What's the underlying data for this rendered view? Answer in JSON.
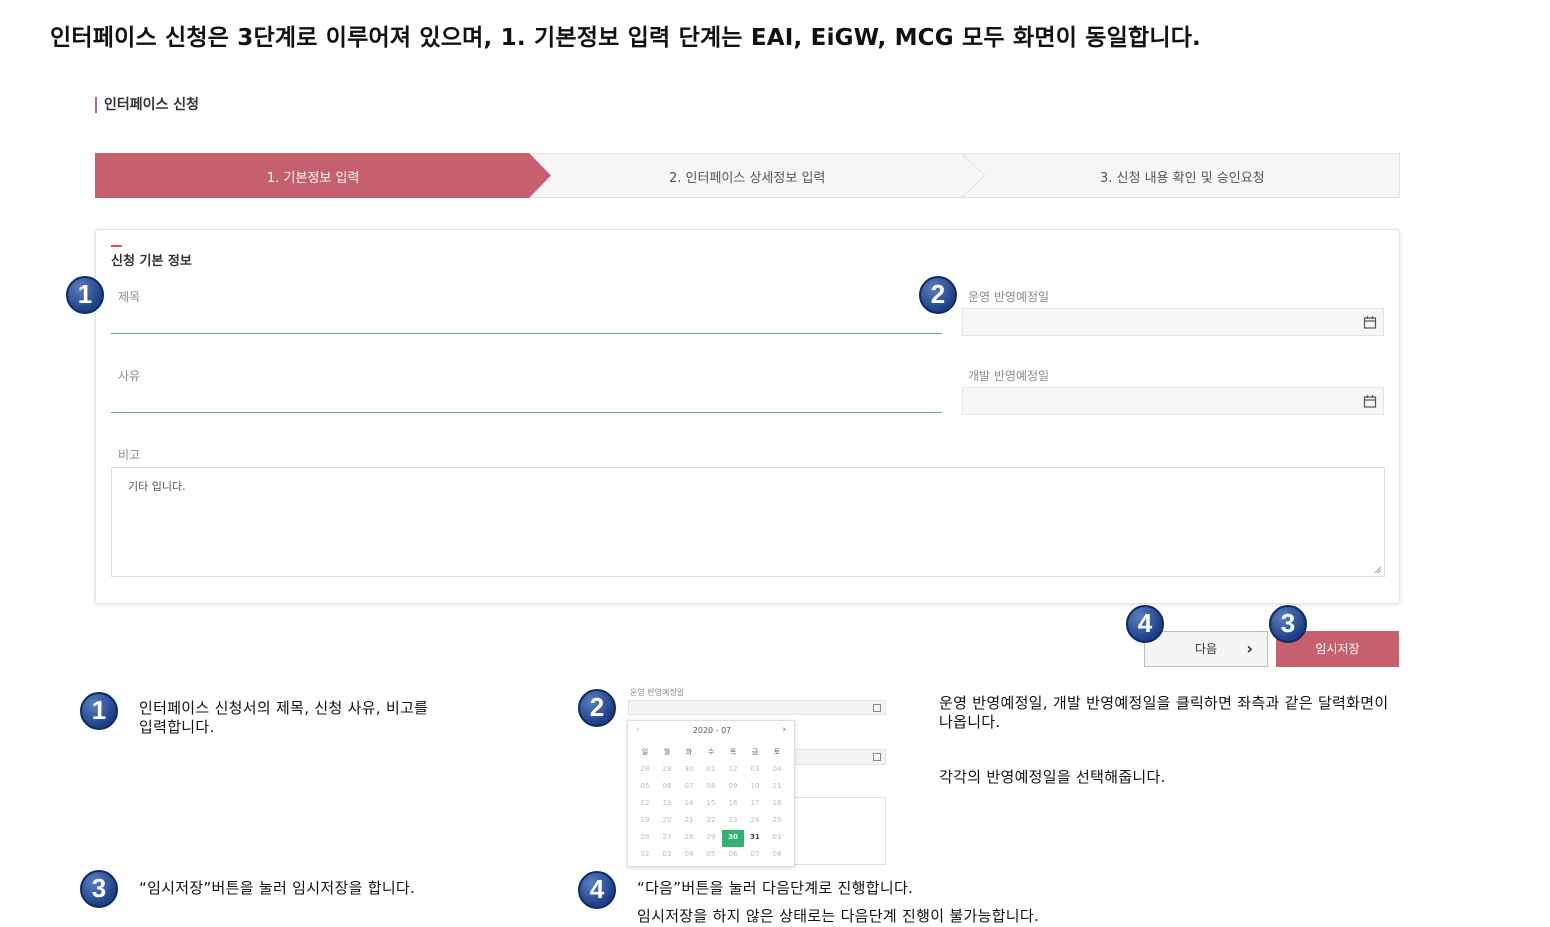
{
  "headline": "인터페이스 신청은 3단계로 이루어져 있으며, 1. 기본정보 입력 단계는 EAI, EiGW, MCG 모두 화면이 동일합니다.",
  "page_title": "인터페이스 신청",
  "steps": [
    {
      "label": "1. 기본정보 입력"
    },
    {
      "label": "2. 인터페이스 상세정보 입력"
    },
    {
      "label": "3. 신청 내용 확인 및 승인요청"
    }
  ],
  "form": {
    "section_title": "신청 기본 정보",
    "title_label": "제목",
    "reason_label": "사유",
    "note_label": "비고",
    "note_value": "기타 입니다.",
    "ops_date_label": "운영 반영예정일",
    "dev_date_label": "개발 반영예정일"
  },
  "buttons": {
    "next": "다음",
    "temp_save": "임시저장"
  },
  "badges": [
    "1",
    "2",
    "3",
    "4"
  ],
  "descriptions": {
    "d1": "인터페이스 신청서의 제목, 신청 사유, 비고를",
    "d1b": "입력합니다.",
    "d2a": "운영 반영예정일, 개발 반영예정일을 클릭하면 좌측과 같은 달력화면이",
    "d2b": "나옵니다.",
    "d2c": "각각의 반영예정일을 선택해줍니다.",
    "d3": "“임시저장”버튼을 눌러 임시저장을 합니다.",
    "d4a": "“다음”버튼을 눌러 다음단계로 진행합니다.",
    "d4b": "임시저장을 하지 않은 상태로는 다음단계 진행이 불가능합니다."
  },
  "calendar": {
    "label": "운영 반영예정일",
    "year_month": "2020 - 07",
    "weekdays": [
      "일",
      "월",
      "화",
      "수",
      "목",
      "금",
      "토"
    ],
    "weeks": [
      [
        "28",
        "29",
        "30",
        "01",
        "02",
        "03",
        "04"
      ],
      [
        "05",
        "06",
        "07",
        "08",
        "09",
        "10",
        "11"
      ],
      [
        "12",
        "13",
        "14",
        "15",
        "16",
        "17",
        "18"
      ],
      [
        "19",
        "20",
        "21",
        "22",
        "23",
        "24",
        "25"
      ],
      [
        "26",
        "27",
        "28",
        "29",
        "30",
        "31",
        "01"
      ],
      [
        "02",
        "03",
        "04",
        "05",
        "06",
        "07",
        "08"
      ]
    ],
    "selected": "30",
    "highlight": "31"
  },
  "colors": {
    "accent": "#c7606e",
    "field_underline": "#6aa88a",
    "selected_day": "#2fb36e",
    "badge": "#1e3f86"
  }
}
